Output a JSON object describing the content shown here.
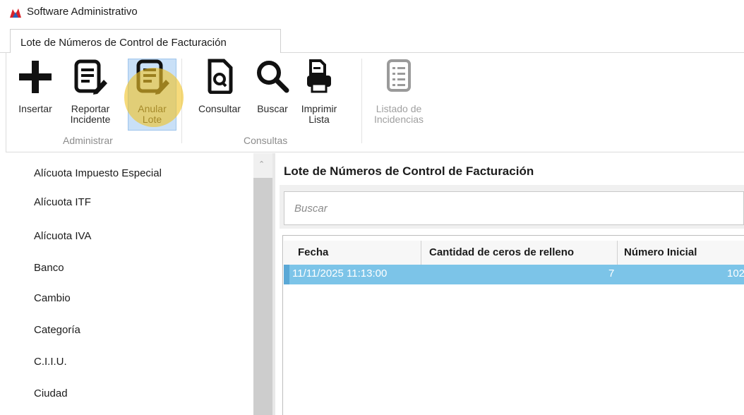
{
  "window": {
    "title": "Software Administrativo"
  },
  "ribbon": {
    "tab_label": "Lote de Números de Control de Facturación",
    "buttons": [
      {
        "label": "Insertar",
        "icon": "plus-icon"
      },
      {
        "label": "Reportar\nIncidente",
        "icon": "report-doc-icon"
      },
      {
        "label": "Anular\nLote",
        "icon": "cancel-doc-icon"
      },
      {
        "label": "Consultar",
        "icon": "query-doc-icon"
      },
      {
        "label": "Buscar",
        "icon": "search-icon"
      },
      {
        "label": "Imprimir\nLista",
        "icon": "print-icon"
      },
      {
        "label": "Listado de\nIncidencias",
        "icon": "incident-list-icon"
      }
    ],
    "groups": {
      "admin": "Administrar",
      "consultas": "Consultas"
    }
  },
  "sidebar": {
    "items": [
      "Alícuota Impuesto Especial",
      "Alícuota ITF",
      "Alícuota IVA",
      "Banco",
      "Cambio",
      "Categoría",
      "C.I.I.U.",
      "Ciudad"
    ]
  },
  "main": {
    "title": "Lote de Números de Control de Facturación",
    "search_placeholder": "Buscar",
    "columns": [
      "Fecha",
      "Cantidad de ceros de relleno",
      "Número Inicial"
    ],
    "rows": [
      {
        "fecha": "11/11/2025 11:13:00",
        "ceros": "7",
        "numero_inicial": "102"
      }
    ]
  },
  "colors": {
    "selected_row": "#7cc4e8",
    "highlight": "#f0c428",
    "active_button": "#c9e0f7"
  }
}
